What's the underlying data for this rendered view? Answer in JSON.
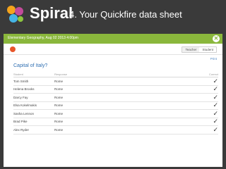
{
  "brand": {
    "name": "Spiral",
    "slide_title": "4. Your Quickfire data sheet"
  },
  "window": {
    "title": "Elementary Geography, Aug 02 2013 4:00pm",
    "close_label": "✕",
    "tabs": [
      {
        "label": "Teacher",
        "active": true
      },
      {
        "label": "Student",
        "active": false
      }
    ],
    "print_label": "Print"
  },
  "question": "Capital of Italy?",
  "table": {
    "headers": {
      "student": "Student",
      "response": "Response",
      "correct": "Correct"
    },
    "rows": [
      {
        "student": "Tom Smith",
        "response": "Rome",
        "correct": "✓"
      },
      {
        "student": "Helena Brooks",
        "response": "Rome",
        "correct": "✓"
      },
      {
        "student": "Darcy Fay",
        "response": "Rome",
        "correct": "✓"
      },
      {
        "student": "Elsa Kokelmakis",
        "response": "Rome",
        "correct": "✓"
      },
      {
        "student": "Sasha Lennon",
        "response": "Rome",
        "correct": "✓"
      },
      {
        "student": "Brad Pike",
        "response": "Rome",
        "correct": "✓"
      },
      {
        "student": "Alex Ryder",
        "response": "Rome",
        "correct": "✓"
      }
    ]
  },
  "colors": {
    "accent_green": "#8ab73c",
    "link_blue": "#2f6fb2",
    "background": "#3a3a3a"
  }
}
